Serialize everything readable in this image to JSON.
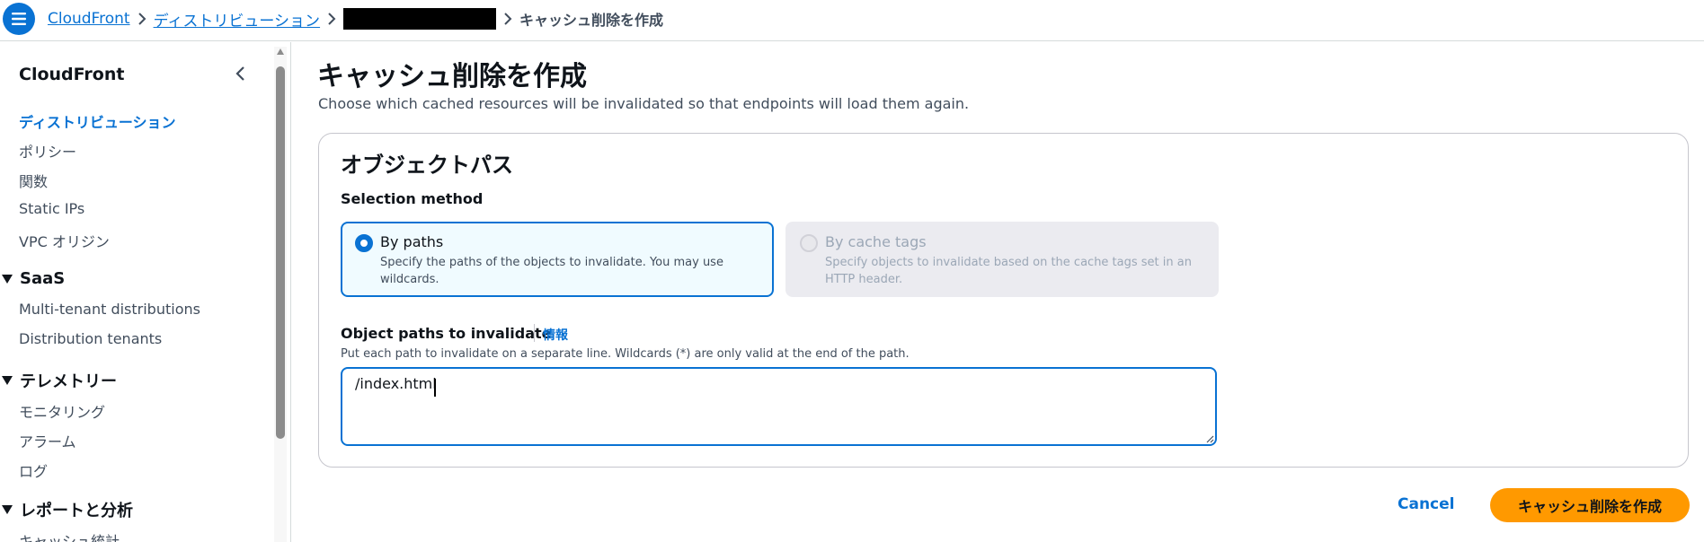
{
  "header": {
    "menu_icon": "hamburger-menu-icon",
    "breadcrumbs": [
      {
        "label": "CloudFront"
      },
      {
        "label": "ディストリビューション"
      },
      {
        "label": ""
      },
      {
        "label": "キャッシュ削除を作成"
      }
    ]
  },
  "sidebar": {
    "title": "CloudFront",
    "items": [
      {
        "label": "ディストリビューション",
        "active": true
      },
      {
        "label": "ポリシー"
      },
      {
        "label": "関数"
      },
      {
        "label": "Static IPs"
      },
      {
        "label": "VPC オリジン"
      }
    ],
    "sections": [
      {
        "label": "SaaS",
        "items": [
          {
            "label": "Multi-tenant distributions"
          },
          {
            "label": "Distribution tenants"
          }
        ]
      },
      {
        "label": "テレメトリー",
        "items": [
          {
            "label": "モニタリング"
          },
          {
            "label": "アラーム"
          },
          {
            "label": "ログ"
          }
        ]
      },
      {
        "label": "レポートと分析",
        "items": [
          {
            "label": "キャッシュ統計"
          }
        ]
      }
    ]
  },
  "main": {
    "title": "キャッシュ削除を作成",
    "description": "Choose which cached resources will be invalidated so that endpoints will load them again.",
    "panel": {
      "title": "オブジェクトパス",
      "selection_label": "Selection method",
      "options": [
        {
          "title": "By paths",
          "description": "Specify the paths of the objects to invalidate. You may use wildcards.",
          "selected": true,
          "disabled": false
        },
        {
          "title": "By cache tags",
          "description": "Specify objects to invalidate based on the cache tags set in an HTTP header.",
          "selected": false,
          "disabled": true
        }
      ],
      "paths_label": "Object paths to invalidate",
      "info_link": "情報",
      "paths_hint": "Put each path to invalidate on a separate line. Wildcards (*) are only valid at the end of the path.",
      "paths_value": "/index.html"
    }
  },
  "footer": {
    "cancel_label": "Cancel",
    "submit_label": "キャッシュ削除を作成"
  },
  "colors": {
    "accent": "#0972d3",
    "primary_button": "#ff9900"
  }
}
